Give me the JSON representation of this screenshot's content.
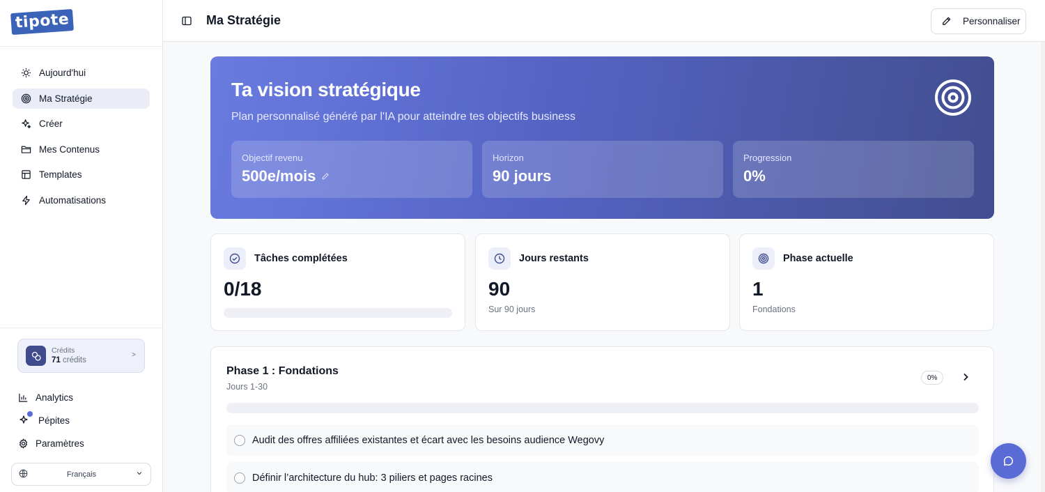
{
  "brand": {
    "logo_text": "tipote"
  },
  "sidebar": {
    "items": [
      {
        "label": "Aujourd'hui",
        "icon": "sun-icon",
        "active": false
      },
      {
        "label": "Ma Stratégie",
        "icon": "target-icon",
        "active": true
      },
      {
        "label": "Créer",
        "icon": "sparkles-icon",
        "active": false
      },
      {
        "label": "Mes Contenus",
        "icon": "folder-icon",
        "active": false
      },
      {
        "label": "Templates",
        "icon": "layout-icon",
        "active": false
      },
      {
        "label": "Automatisations",
        "icon": "lightning-icon",
        "active": false
      }
    ],
    "credits": {
      "label": "Crédits",
      "value": "71",
      "unit": "crédits",
      "chevron": ">"
    },
    "bottom_links": {
      "analytics": "Analytics",
      "pepites": "Pépites",
      "settings": "Paramètres"
    },
    "language": "Français"
  },
  "header": {
    "title": "Ma Stratégie",
    "personalize_label": "Personnaliser"
  },
  "hero": {
    "title": "Ta vision stratégique",
    "subtitle": "Plan personnalisé généré par l'IA pour atteindre tes objectifs business",
    "stats": [
      {
        "label": "Objectif revenu",
        "value": "500e/mois"
      },
      {
        "label": "Horizon",
        "value": "90 jours"
      },
      {
        "label": "Progression",
        "value": "0%"
      }
    ]
  },
  "cards": {
    "tasks": {
      "title": "Tâches complétées",
      "value": "0/18",
      "progress": 0
    },
    "days": {
      "title": "Jours restants",
      "value": "90",
      "sub": "Sur 90 jours"
    },
    "phase": {
      "title": "Phase actuelle",
      "value": "1",
      "sub": "Fondations"
    }
  },
  "phase_section": {
    "title": "Phase 1 : Fondations",
    "subtitle": "Jours 1-30",
    "percent": "0%",
    "progress": 0,
    "tasks": [
      "Audit des offres affiliées existantes et écart avec les besoins audience Wegovy",
      "Définir l’architecture du hub: 3 piliers et pages racines"
    ]
  },
  "colors": {
    "accent": "#5b6bd6",
    "hero_start": "#6a7be0",
    "hero_end": "#414e8f",
    "active_nav_bg": "#eaedf8"
  }
}
